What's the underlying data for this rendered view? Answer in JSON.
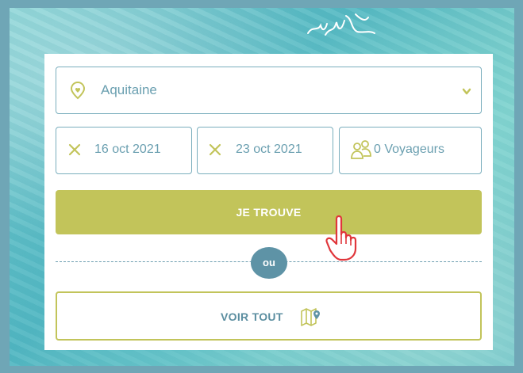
{
  "search": {
    "region": {
      "value": "Aquitaine",
      "icon": "map-pin-icon",
      "chevron": "chevron-down-icon"
    },
    "arrival": {
      "value": "16 oct 2021",
      "icon": "close-icon"
    },
    "departure": {
      "value": "23 oct 2021",
      "icon": "close-icon"
    },
    "travelers": {
      "value": "0 Voyageurs",
      "icon": "people-icon"
    },
    "submit_label": "JE TROUVE"
  },
  "separator": {
    "label": "ou"
  },
  "view_all": {
    "label": "VOIR TOUT",
    "icon": "map-icon"
  },
  "colors": {
    "accent": "#c2c45a",
    "primary": "#5e93a6",
    "field_border": "#7aaebd",
    "text": "#6a9fb0"
  }
}
